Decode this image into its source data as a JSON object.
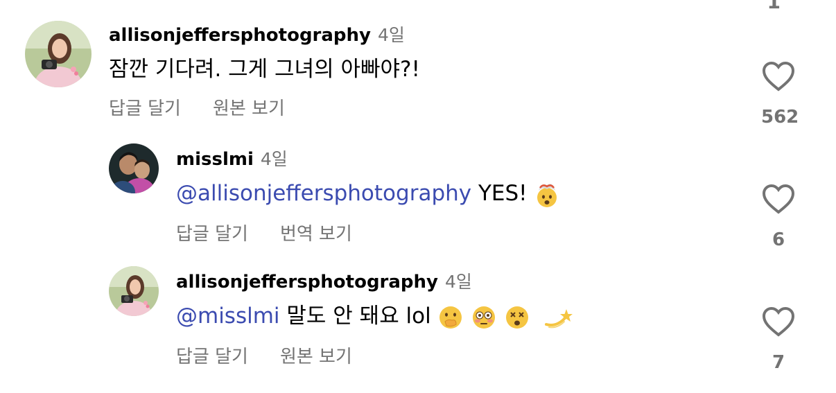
{
  "top_partial_count": "1",
  "comments": [
    {
      "username": "allisonjeffersphotography",
      "time": "4일",
      "text": "잠깐 기다려. 그게 그녀의 아빠야?!",
      "actions": [
        "답글 달기",
        "원본 보기"
      ],
      "likes": "562",
      "avatar_icon": "profile-photo-woman-camera"
    },
    {
      "username": "misslmi",
      "time": "4일",
      "mention": "@allisonjeffersphotography",
      "text": " YES!",
      "emojis": [
        "exploding-head-emoji"
      ],
      "actions": [
        "답글 달기",
        "번역 보기"
      ],
      "likes": "6",
      "avatar_icon": "profile-photo-two-people"
    },
    {
      "username": "allisonjeffersphotography",
      "time": "4일",
      "mention": "@misslmi",
      "text": " 말도 안 돼요 lol",
      "emojis": [
        "face-with-hand-over-mouth-emoji",
        "flushed-face-emoji",
        "dizzy-face-emoji",
        "dizzy-star-emoji"
      ],
      "actions": [
        "답글 달기",
        "원본 보기"
      ],
      "likes": "7",
      "avatar_icon": "profile-photo-woman-camera"
    }
  ],
  "colors": {
    "username": "#000000",
    "secondary": "#737373",
    "mention": "#3b4bb0"
  }
}
